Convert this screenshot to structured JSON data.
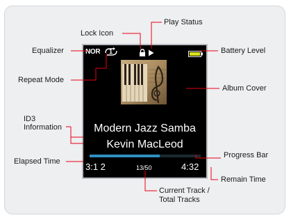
{
  "device": {
    "equalizer_value": "NOR",
    "repeat_value": "1",
    "song_title": "Modern Jazz Samba",
    "artist": "Kevin MacLeod",
    "elapsed_time": "3:1 2",
    "track_counter": "13/50",
    "remain_time": "4:32",
    "progress_fraction": 0.63
  },
  "callouts": {
    "play_status": "Play Status",
    "lock_icon": "Lock Icon",
    "equalizer": "Equalizer",
    "battery_level": "Battery Level",
    "repeat_mode": "Repeat Mode",
    "album_cover": "Album Cover",
    "id3_line1": "ID3",
    "id3_line2": "Information",
    "progress_bar": "Progress Bar",
    "elapsed_time": "Elapsed Time",
    "remain_time": "Remain Time",
    "current_track_line1": "Current Track /",
    "current_track_line2": "Total Tracks"
  },
  "colors": {
    "leader_line": "#e60012",
    "progress_fill": "#2f8fc0",
    "progress_track": "#1a2a33",
    "battery": "#d8e020"
  },
  "icons": [
    "repeat-icon",
    "lock-icon",
    "play-icon",
    "battery-icon",
    "album-cover-image"
  ]
}
